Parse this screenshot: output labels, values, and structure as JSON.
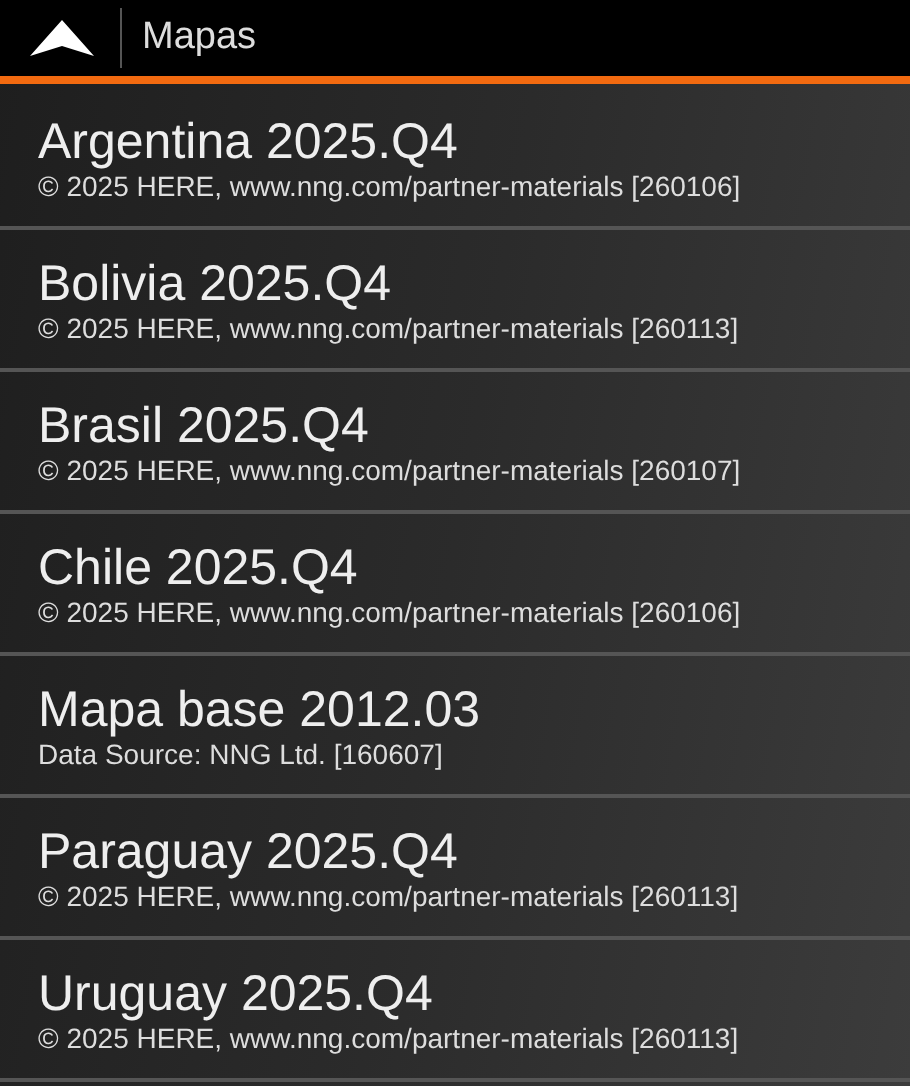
{
  "header": {
    "title": "Mapas"
  },
  "maps": [
    {
      "name": "Argentina 2025.Q4",
      "source": "© 2025 HERE, www.nng.com/partner-materials [260106]"
    },
    {
      "name": "Bolivia 2025.Q4",
      "source": "© 2025 HERE, www.nng.com/partner-materials [260113]"
    },
    {
      "name": "Brasil 2025.Q4",
      "source": "© 2025 HERE, www.nng.com/partner-materials [260107]"
    },
    {
      "name": "Chile 2025.Q4",
      "source": "© 2025 HERE, www.nng.com/partner-materials [260106]"
    },
    {
      "name": "Mapa base 2012.03",
      "source": "Data Source: NNG Ltd. [160607]"
    },
    {
      "name": "Paraguay 2025.Q4",
      "source": "© 2025 HERE, www.nng.com/partner-materials [260113]"
    },
    {
      "name": "Uruguay 2025.Q4",
      "source": "© 2025 HERE, www.nng.com/partner-materials [260113]"
    }
  ]
}
